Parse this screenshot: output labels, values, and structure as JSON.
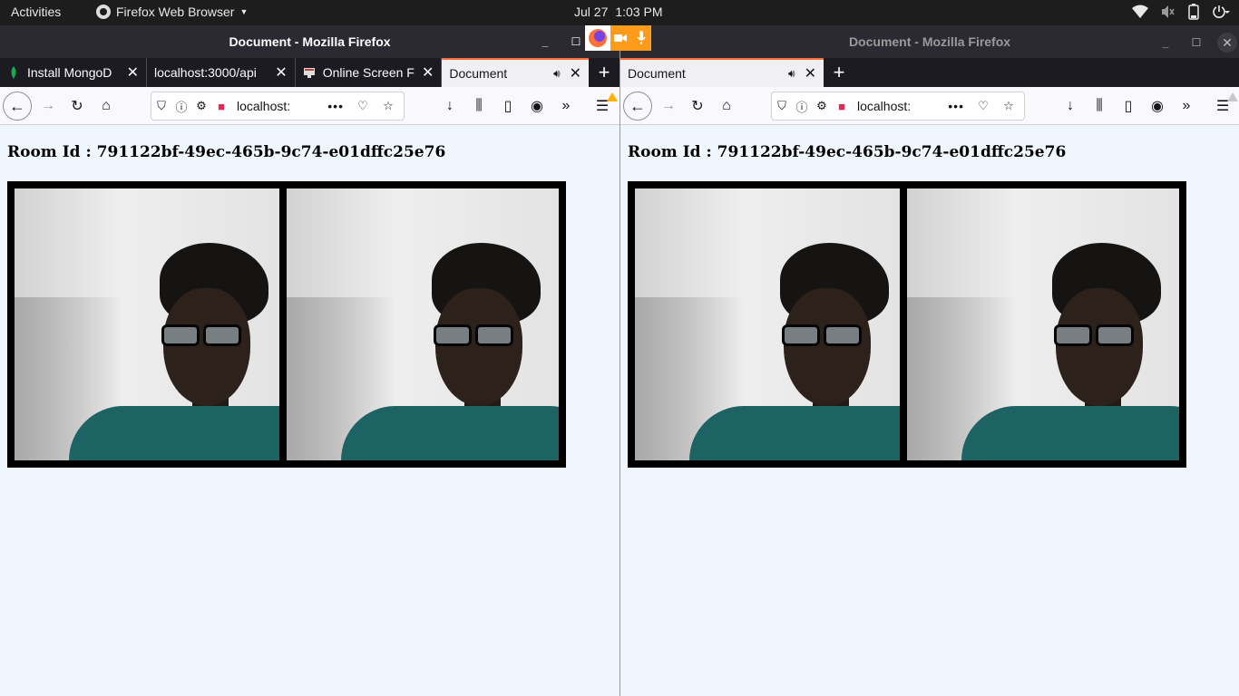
{
  "topbar": {
    "activities": "Activities",
    "app_name": "Firefox Web Browser",
    "date": "Jul 27",
    "time": "1:03 PM",
    "tray_icons": [
      "wifi-icon",
      "volume-muted-icon",
      "battery-icon",
      "power-menu-icon"
    ]
  },
  "left_window": {
    "title": "Document - Mozilla Firefox",
    "tabs": [
      {
        "label": "Install MongoD",
        "icon": "mongodb-leaf-icon"
      },
      {
        "label": "localhost:3000/api"
      },
      {
        "label": "Online Screen F",
        "icon": "monitor-icon"
      },
      {
        "label": "Document",
        "active": true
      }
    ],
    "url": "localhost:",
    "room_text": "Room Id : 791122bf-49ec-465b-9c74-e01dffc25e76"
  },
  "right_window": {
    "title": "Document - Mozilla Firefox",
    "tabs": [
      {
        "label": "Document",
        "active": true
      }
    ],
    "url": "localhost:",
    "room_text": "Room Id : 791122bf-49ec-465b-9c74-e01dffc25e76"
  },
  "colors": {
    "page_bg": "#f0f6fe",
    "tab_accent": "#ff6e3a",
    "sharing_indicator": "#ff9b1a"
  }
}
